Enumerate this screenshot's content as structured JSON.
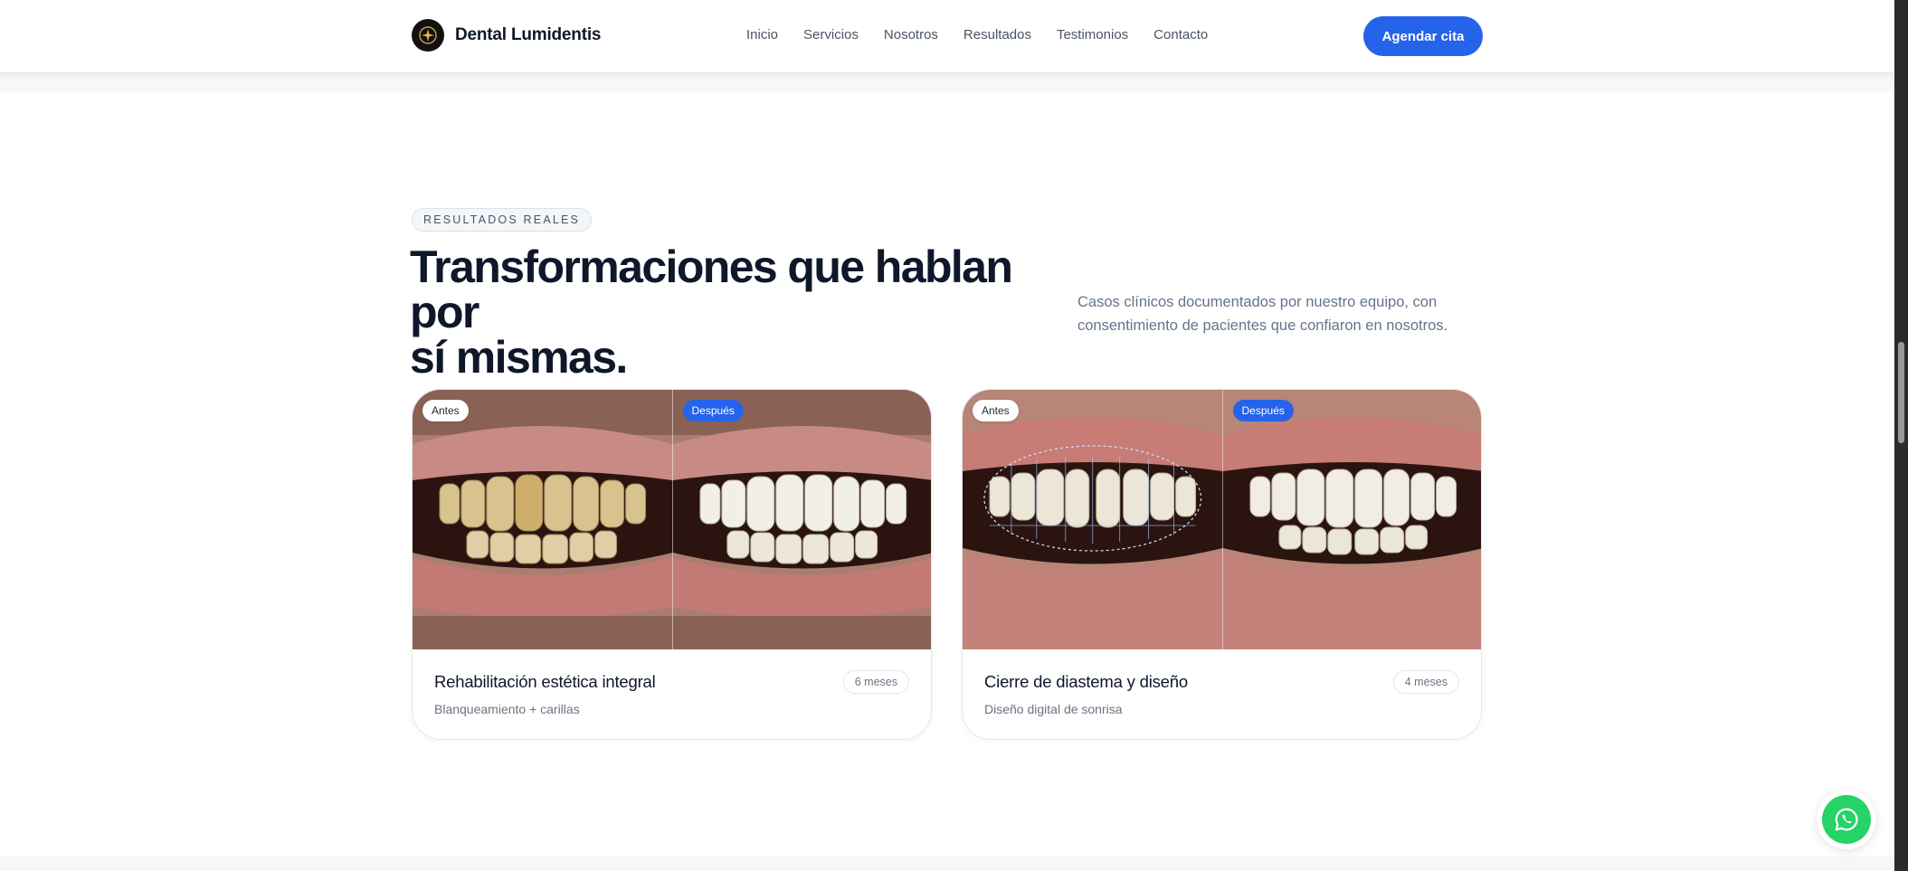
{
  "brand": {
    "name": "Dental Lumidentis"
  },
  "nav": {
    "items": [
      "Inicio",
      "Servicios",
      "Nosotros",
      "Resultados",
      "Testimonios",
      "Contacto"
    ],
    "cta_label": "Agendar cita"
  },
  "section": {
    "eyebrow": "RESULTADOS REALES",
    "headline_line1": "Transformaciones que hablan por",
    "headline_line2": "sí mismas.",
    "lead_line1": "Casos clínicos documentados por nuestro equipo, con",
    "lead_line2": "consentimiento de pacientes que confiaron en nosotros."
  },
  "cases": [
    {
      "before_label": "Antes",
      "after_label": "Después",
      "title": "Rehabilitación estética integral",
      "subtitle": "Blanqueamiento + carillas",
      "duration": "6 meses"
    },
    {
      "before_label": "Antes",
      "after_label": "Después",
      "title": "Cierre de diastema y diseño",
      "subtitle": "Diseño digital de sonrisa",
      "duration": "4 meses"
    }
  ],
  "colors": {
    "accent": "#2563eb",
    "whatsapp": "#25d366",
    "text": "#0f172a",
    "muted": "#64748b"
  },
  "icons": {
    "logo": "sparkle-icon",
    "whatsapp": "whatsapp-icon"
  }
}
